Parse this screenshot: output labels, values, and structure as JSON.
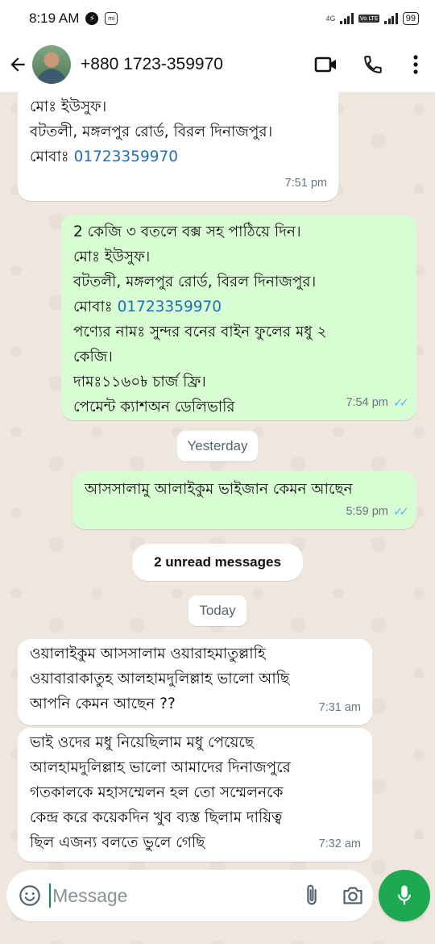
{
  "status_bar": {
    "time": "8:19 AM",
    "network": "4G",
    "volte": "Vo LTE",
    "battery": "99"
  },
  "header": {
    "contact_name": "+880 1723-359970"
  },
  "messages": [
    {
      "direction": "in",
      "lines": [
        "মোঃ ইউসুফ।",
        "বটতলী, মঙ্গলপুর রোর্ড, বিরল দিনাজপুর।",
        "মোবাঃ "
      ],
      "phone": "01723359970",
      "time": "7:51 pm"
    },
    {
      "direction": "out",
      "lines": [
        "2 কেজি ৩ বতলে বক্স সহ  পাঠিয়ে দিন।",
        "মোঃ ইউসুফ।",
        "বটতলী, মঙ্গলপুর রোর্ড, বিরল দিনাজপুর।",
        "মোবাঃ ",
        "পণ্যের নামঃ সুন্দর বনের বাইন ফুলের মধু ২",
        "কেজি।",
        "দামঃ১১৬০৳ চার্জ ফ্রি।",
        "পেমেন্ট ক্যাশঅন ডেলিভারি"
      ],
      "phone": "01723359970",
      "time": "7:54 pm"
    },
    {
      "direction": "out",
      "lines": [
        "আসসালামু আলাইকুম ভাইজান কেমন আছেন"
      ],
      "time": "5:59 pm"
    },
    {
      "direction": "in",
      "lines": [
        "ওয়ালাইকুম আসসালাম ওয়ারাহমাতুল্লাহি",
        "ওয়াবারাকাতুহ আলহামদুলিল্লাহ ভালো আছি",
        "আপনি কেমন আছেন ??"
      ],
      "time": "7:31 am"
    },
    {
      "direction": "in",
      "lines": [
        "ভাই ওদের মধু নিয়েছিলাম মধু পেয়েছে",
        "আলহামদুলিল্লাহ ভালো আমাদের দিনাজপুরে",
        "গতকালকে মহাসম্মেলন হল তো সম্মেলনকে",
        "কেন্দ্র করে কয়েকদিন খুব ব্যস্ত ছিলাম দায়িত্ব",
        "ছিল এজন্য বলতে ভুলে গেছি"
      ],
      "time": "7:32 am"
    }
  ],
  "dividers": {
    "yesterday": "Yesterday",
    "unread": "2 unread messages",
    "today": "Today"
  },
  "input": {
    "placeholder": "Message"
  },
  "icons": {
    "back": "arrow-left-icon",
    "video": "video-camera-icon",
    "call": "phone-icon",
    "menu": "more-vertical-icon",
    "emoji": "emoji-icon",
    "attach": "paperclip-icon",
    "camera": "camera-icon",
    "mic": "microphone-icon"
  },
  "colors": {
    "outgoing_bubble": "#d9fdd3",
    "incoming_bubble": "#ffffff",
    "read_ticks": "#53bdeb",
    "mic_button": "#1da851",
    "link": "#1f6fb5"
  }
}
